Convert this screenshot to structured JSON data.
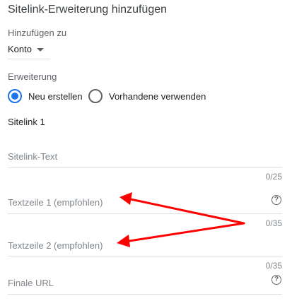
{
  "title": "Sitelink-Erweiterung hinzufügen",
  "add_to": {
    "label": "Hinzufügen zu",
    "selected": "Konto"
  },
  "extension": {
    "label": "Erweiterung",
    "options": [
      {
        "label": "Neu erstellen",
        "selected": true
      },
      {
        "label": "Vorhandene verwenden",
        "selected": false
      }
    ]
  },
  "sitelink": {
    "heading": "Sitelink 1",
    "fields": [
      {
        "placeholder": "Sitelink-Text",
        "counter": "0/25"
      },
      {
        "placeholder": "Textzeile 1 (empfohlen)",
        "counter": "0/35",
        "help": "?"
      },
      {
        "placeholder": "Textzeile 2 (empfohlen)",
        "counter": "0/35"
      },
      {
        "placeholder": "Finale URL",
        "help": "?"
      }
    ]
  },
  "colors": {
    "accent": "#1a73e8",
    "annotation_arrow": "#ff0000"
  }
}
